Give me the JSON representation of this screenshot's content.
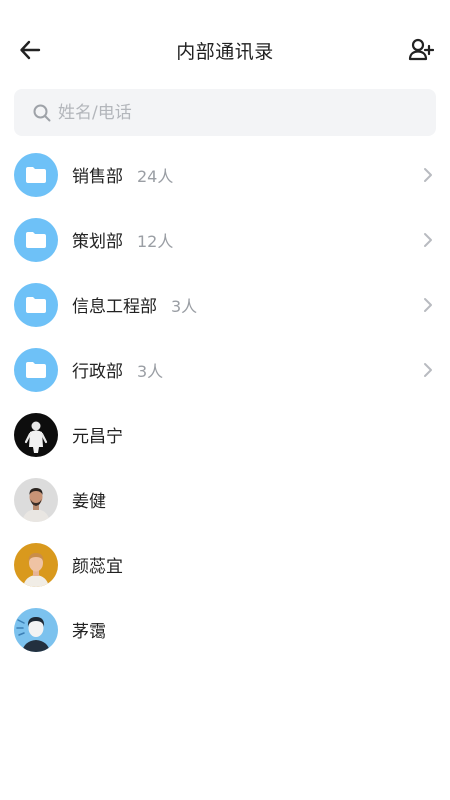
{
  "header": {
    "title": "内部通讯录",
    "back_icon": "arrow-left-icon",
    "add_icon": "add-user-icon"
  },
  "search": {
    "placeholder": "姓名/电话",
    "icon": "search-icon"
  },
  "departments": [
    {
      "name": "销售部",
      "count": "24人"
    },
    {
      "name": "策划部",
      "count": "12人"
    },
    {
      "name": "信息工程部",
      "count": "3人"
    },
    {
      "name": "行政部",
      "count": "3人"
    }
  ],
  "contacts": [
    {
      "name": "元昌宁"
    },
    {
      "name": "姜健"
    },
    {
      "name": "颜蕊宜"
    },
    {
      "name": "茅霭"
    }
  ],
  "colors": {
    "accent_folder": "#6ec1f7",
    "search_bg": "#f3f4f6",
    "muted_text": "#9a9ea4"
  }
}
